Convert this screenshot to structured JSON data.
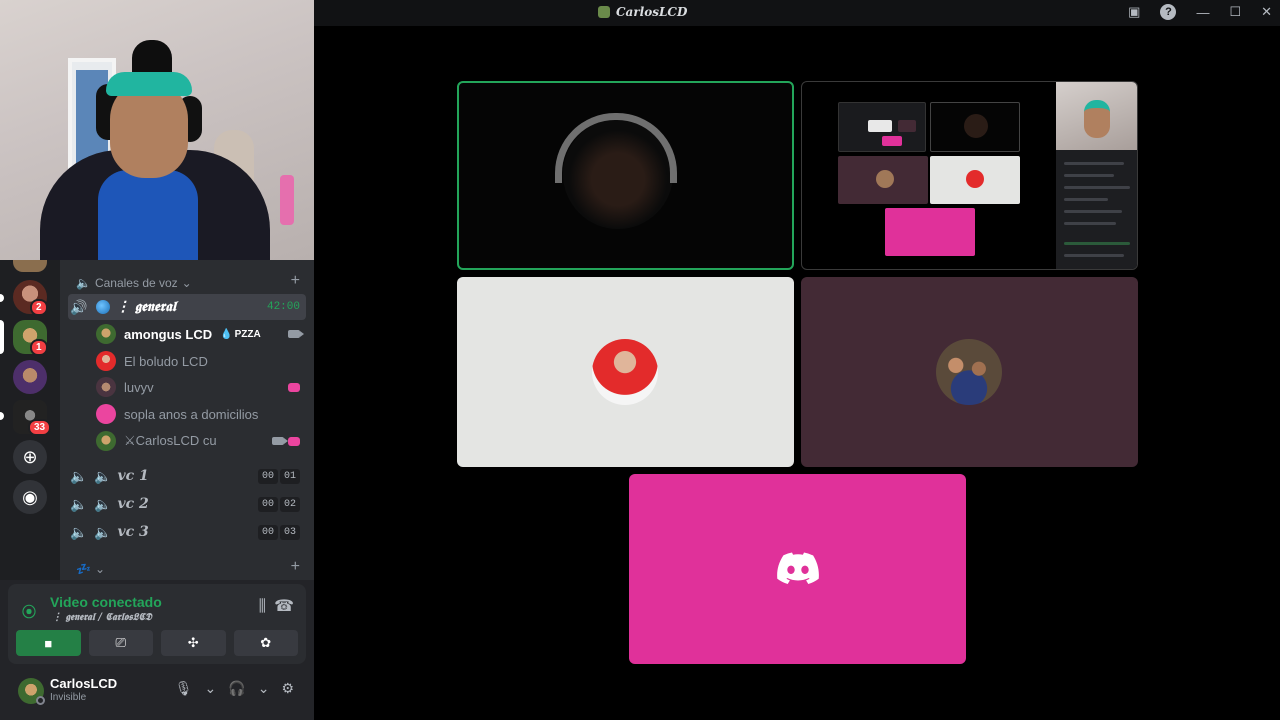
{
  "window": {
    "title": "CarlosLCD"
  },
  "servers": [
    {
      "badge": "2"
    },
    {
      "badge": "1"
    },
    {
      "badge": ""
    },
    {
      "badge": "33"
    }
  ],
  "rail": {
    "add_icon": "plus-icon",
    "discover_icon": "compass-icon"
  },
  "channels": {
    "category_label": "Canales de voz",
    "active_channel": {
      "name": "⋮ 𝖌𝖊𝖓𝖊𝖗𝖆𝖑",
      "timer": "42:00"
    },
    "users": [
      {
        "name": "amongus LCD",
        "tag": "PZZA",
        "me": true
      },
      {
        "name": "El boludo LCD"
      },
      {
        "name": "luvyv"
      },
      {
        "name": "sopla anos a domicilios"
      },
      {
        "name": "⚔CarlosLCD cu"
      }
    ],
    "other_channels": [
      {
        "name": "𝒗𝒄 1",
        "a": "00",
        "b": "01"
      },
      {
        "name": "𝒗𝒄 2",
        "a": "00",
        "b": "02"
      },
      {
        "name": "𝒗𝒄 3",
        "a": "00",
        "b": "03"
      }
    ]
  },
  "voice": {
    "status": "Video conectado",
    "location": "⋮ 𝖌𝖊𝖓𝖊𝖗𝖆𝖑 / 𝕮𝖆𝖗𝖑𝖔𝖘𝕷𝕮𝕯"
  },
  "user": {
    "name": "CarlosLCD",
    "status": "Invisible"
  },
  "colors": {
    "green": "#23a55a",
    "pink": "#e0319a",
    "red": "#f23f43",
    "blurple": "#5865f2"
  }
}
